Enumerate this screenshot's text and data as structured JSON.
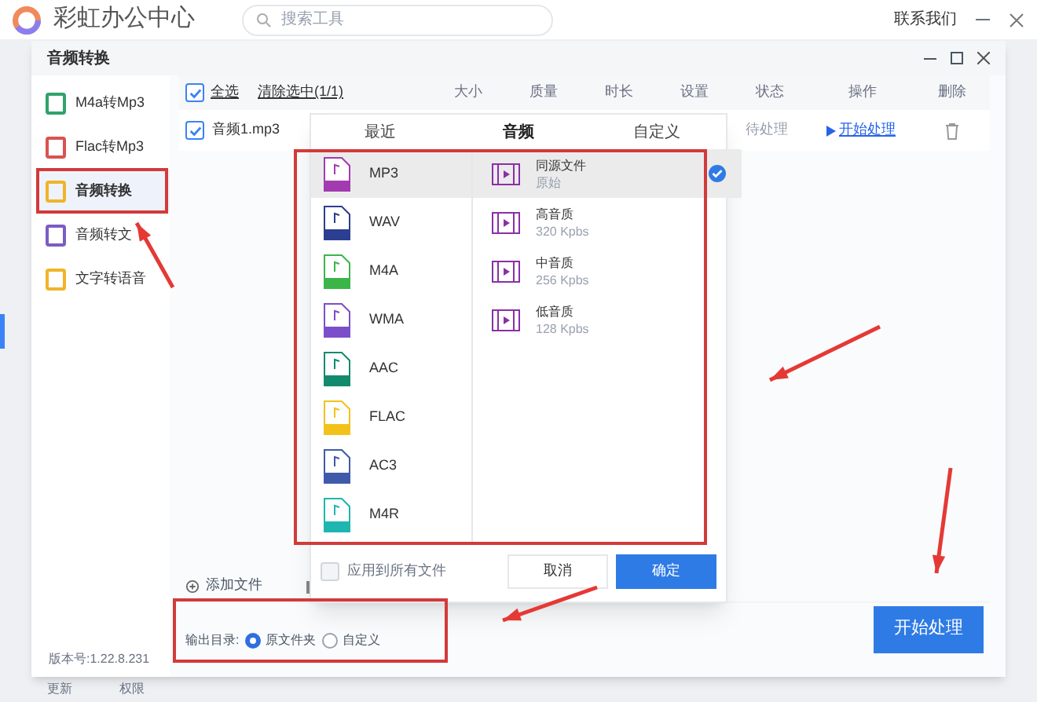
{
  "app": {
    "title": "彩虹办公中心",
    "search": {
      "placeholder": "搜索工具"
    },
    "contact": "联系我们",
    "footer": [
      "更新",
      "权限"
    ]
  },
  "window": {
    "title": "音频转换"
  },
  "sidebar": {
    "items": [
      {
        "label": "M4a转Mp3",
        "color": "#2fa36b",
        "selected": false
      },
      {
        "label": "Flac转Mp3",
        "color": "#d9534f",
        "selected": false
      },
      {
        "label": "音频转换",
        "color": "#f0b429",
        "selected": true
      },
      {
        "label": "音频转文",
        "color": "#7c5cc4",
        "selected": false
      },
      {
        "label": "文字转语音",
        "color": "#f0b429",
        "selected": false
      }
    ],
    "version": "版本号:1.22.8.231"
  },
  "table": {
    "select_all": {
      "label": "全选",
      "checked": true
    },
    "clear": "清除选中(1/1)",
    "columns": [
      "大小",
      "质量",
      "时长",
      "设置",
      "状态",
      "操作",
      "删除"
    ],
    "rows": [
      {
        "name": "音频1.mp3",
        "checked": true,
        "status": "待处理",
        "action": "开始处理"
      }
    ]
  },
  "add_file": "添加文件",
  "popup": {
    "tabs": [
      {
        "label": "最近",
        "selected": false
      },
      {
        "label": "音频",
        "selected": true
      },
      {
        "label": "自定义",
        "selected": false
      }
    ],
    "formats": [
      {
        "label": "MP3",
        "color": "#a23bb0",
        "selected": true
      },
      {
        "label": "WAV",
        "color": "#2c3e8f",
        "selected": false
      },
      {
        "label": "M4A",
        "color": "#3bb54a",
        "selected": false
      },
      {
        "label": "WMA",
        "color": "#7b4fc9",
        "selected": false
      },
      {
        "label": "AAC",
        "color": "#138a6e",
        "selected": false
      },
      {
        "label": "FLAC",
        "color": "#f2c21b",
        "selected": false
      },
      {
        "label": "AC3",
        "color": "#3f5aa8",
        "selected": false
      },
      {
        "label": "M4R",
        "color": "#1fb5b0",
        "selected": false
      }
    ],
    "presets": [
      {
        "name": "同源文件",
        "detail": "原始",
        "selected": true
      },
      {
        "name": "高音质",
        "detail": "320 Kpbs",
        "selected": false
      },
      {
        "name": "中音质",
        "detail": "256 Kpbs",
        "selected": false
      },
      {
        "name": "低音质",
        "detail": "128 Kpbs",
        "selected": false
      }
    ],
    "apply_all": {
      "label": "应用到所有文件",
      "checked": false
    },
    "buttons": [
      "取消",
      "确定"
    ]
  },
  "output": {
    "label": "输出目录:",
    "options": [
      {
        "label": "原文件夹",
        "selected": true
      },
      {
        "label": "自定义",
        "selected": false
      }
    ]
  },
  "start_button": "开始处理"
}
